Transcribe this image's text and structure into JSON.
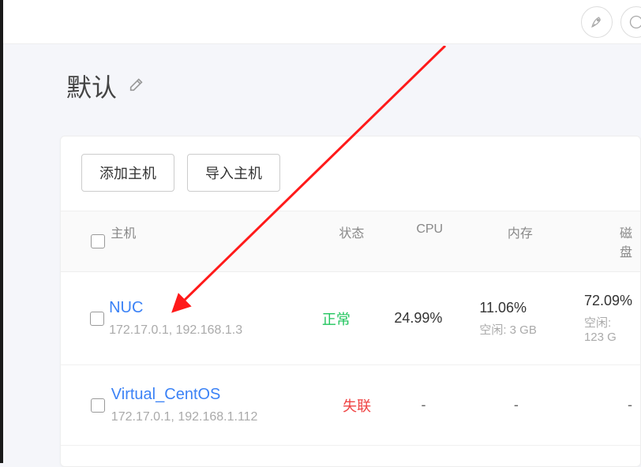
{
  "page": {
    "title": "默认"
  },
  "toolbar": {
    "add_host": "添加主机",
    "import_host": "导入主机"
  },
  "columns": {
    "host": "主机",
    "status": "状态",
    "cpu": "CPU",
    "memory": "内存",
    "disk": "磁盘"
  },
  "rows": [
    {
      "name": "NUC",
      "ips": "172.17.0.1, 192.168.1.3",
      "status_text": "正常",
      "status_class": "status-normal",
      "cpu": "24.99%",
      "mem_pct": "11.06%",
      "mem_free": "空闲: 3 GB",
      "disk_pct": "72.09%",
      "disk_free": "空闲: 123 G"
    },
    {
      "name": "Virtual_CentOS",
      "ips": "172.17.0.1, 192.168.1.112",
      "status_text": "失联",
      "status_class": "status-lost",
      "cpu": "-",
      "mem_pct": "-",
      "mem_free": "",
      "disk_pct": "-",
      "disk_free": ""
    }
  ]
}
